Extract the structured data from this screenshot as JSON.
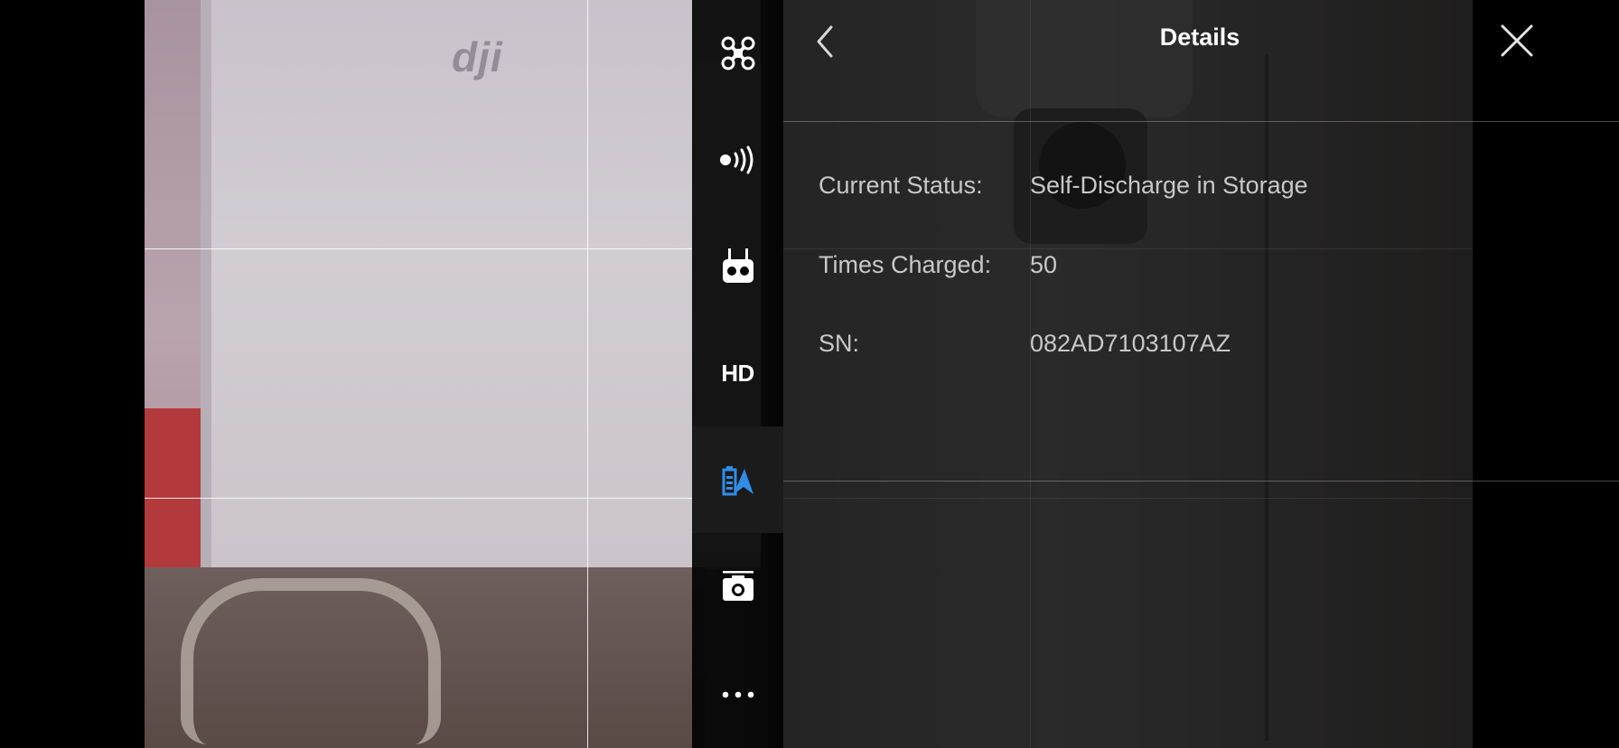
{
  "header": {
    "title": "Details",
    "back_icon": "chevron-left-icon",
    "close_icon": "close-icon"
  },
  "sidebar": {
    "items": [
      {
        "icon": "aircraft-icon",
        "active": false
      },
      {
        "icon": "signal-icon",
        "active": false
      },
      {
        "icon": "remote-controller-icon",
        "active": false
      },
      {
        "icon": "hd-video-icon",
        "label": "HD",
        "active": false
      },
      {
        "icon": "battery-icon",
        "active": true
      },
      {
        "icon": "camera-icon",
        "active": false
      },
      {
        "icon": "more-icon",
        "active": false
      }
    ]
  },
  "details": {
    "current_status": {
      "label": "Current Status:",
      "value": "Self-Discharge in Storage"
    },
    "times_charged": {
      "label": "Times Charged:",
      "value": "50"
    },
    "sn": {
      "label": "SN:",
      "value": "082AD7103107AZ"
    }
  },
  "colors": {
    "accent": "#2f8fe8",
    "text_primary": "#ffffff",
    "text_secondary": "#c8c8c8"
  }
}
